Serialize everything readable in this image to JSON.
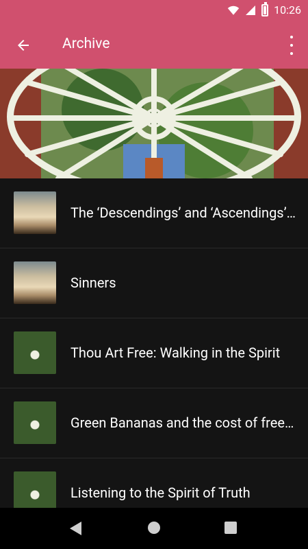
{
  "status_bar": {
    "time": "10:26",
    "icons": [
      "wifi-icon",
      "signal-icon",
      "battery-icon"
    ]
  },
  "app_bar": {
    "title": "Archive",
    "back_icon": "arrow-left-icon",
    "menu_icon": "more-vertical-icon"
  },
  "articles": [
    {
      "title": "The ‘Descendings’ and ‘Ascendings’ of Jesus",
      "thumbnail": "sky"
    },
    {
      "title": "Sinners",
      "thumbnail": "sky"
    },
    {
      "title": "Thou Art Free: Walking in the Spirit",
      "thumbnail": "window"
    },
    {
      "title": "Green Bananas and the cost of freedom",
      "thumbnail": "window"
    },
    {
      "title": "Listening to the Spirit of Truth",
      "thumbnail": "window"
    }
  ],
  "colors": {
    "accent": "#d0506e",
    "background": "#141414",
    "navbar": "#000000",
    "text": "#ffffff"
  }
}
